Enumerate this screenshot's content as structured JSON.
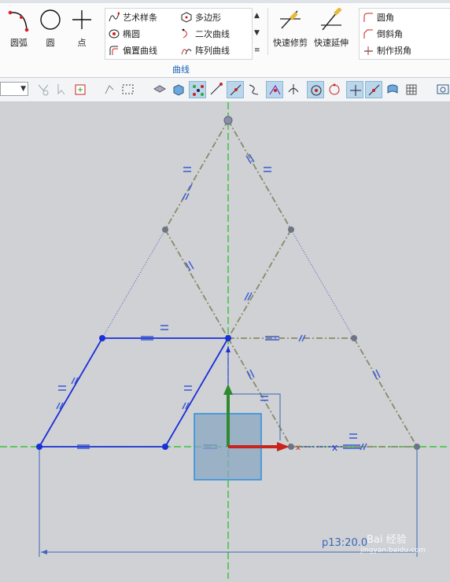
{
  "ribbon": {
    "buttons": {
      "arc": "圆弧",
      "circle": "圆",
      "point": "点"
    },
    "curve_group": {
      "items": [
        "艺术样条",
        "椭圆",
        "偏置曲线"
      ],
      "items2": [
        "多边形",
        "二次曲线",
        "阵列曲线"
      ],
      "label": "曲线"
    },
    "edit": {
      "quick_trim": "快速修剪",
      "quick_extend": "快速延伸"
    },
    "corner": {
      "items": [
        "圆角",
        "倒斜角",
        "制作拐角"
      ]
    }
  },
  "canvas": {
    "dimension_text": "p13:20.0",
    "watermark": "Bai 经验",
    "watermark_url": "jingyan.baidu.com"
  }
}
